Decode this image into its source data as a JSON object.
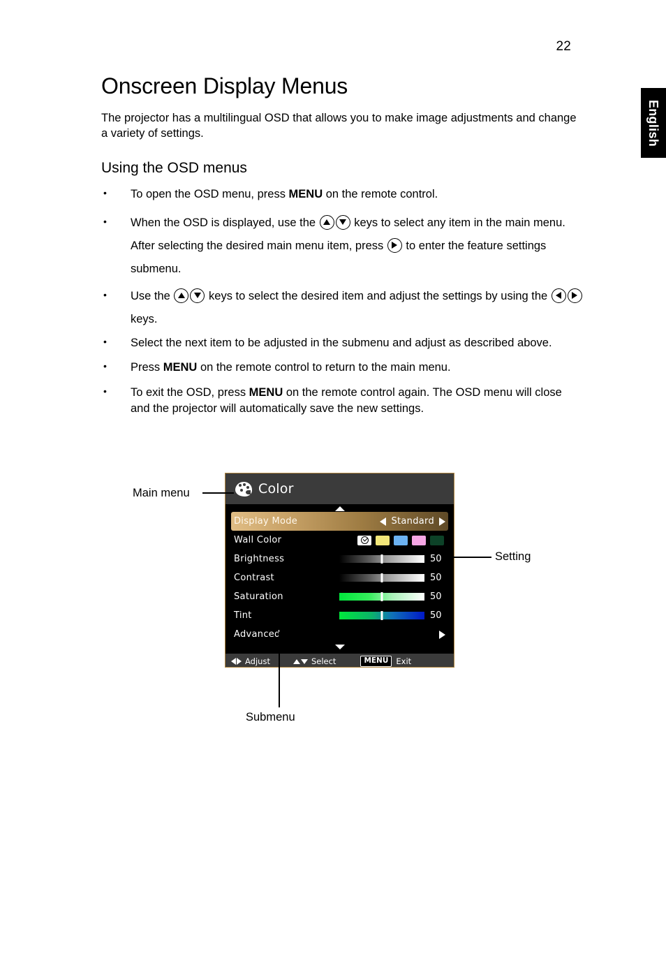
{
  "page": {
    "number": "22",
    "language_tab": "English"
  },
  "article": {
    "title": "Onscreen Display Menus",
    "intro": "The projector has a multilingual OSD that allows you to make image adjustments and change a variety of settings.",
    "subtitle": "Using the OSD menus",
    "bullets": {
      "b1_a": "To open the OSD menu, press ",
      "b1_b": "MENU",
      "b1_c": " on the remote control.",
      "b2_a": "When the OSD is displayed, use the ",
      "b2_b": " keys to select any item in the main menu. After selecting the desired main menu item, press ",
      "b2_c": " to enter the feature settings submenu.",
      "b3_a": "Use the ",
      "b3_b": " keys to select the desired item and adjust the settings by using the ",
      "b3_c": " keys.",
      "b4": "Select the next item to be adjusted in the submenu and adjust as described above.",
      "b5_a": "Press ",
      "b5_b": "MENU",
      "b5_c": " on the remote control to return to the main menu.",
      "b6_a": "To exit the OSD, press ",
      "b6_b": "MENU",
      "b6_c": " on the remote control again. The OSD menu will close and the projector will automatically save the new settings."
    }
  },
  "callouts": {
    "main_menu": "Main menu",
    "setting": "Setting",
    "submenu": "Submenu"
  },
  "osd": {
    "header_title": "Color",
    "header_icon": "palette-icon",
    "scroll_up_icon": "scroll-up-arrow-icon",
    "scroll_down_icon": "scroll-down-arrow-icon",
    "rows": [
      {
        "label": "Display Mode",
        "type": "option",
        "value": "Standard",
        "selected": true
      },
      {
        "label": "Wall Color",
        "type": "swatches",
        "value": ""
      },
      {
        "label": "Brightness",
        "type": "slider",
        "style": "bw",
        "value": "50",
        "position": 50
      },
      {
        "label": "Contrast",
        "type": "slider",
        "style": "bw",
        "value": "50",
        "position": 50
      },
      {
        "label": "Saturation",
        "type": "slider",
        "style": "sat",
        "value": "50",
        "position": 50
      },
      {
        "label": "Tint",
        "type": "slider",
        "style": "tint",
        "value": "50",
        "position": 50
      },
      {
        "label": "Advanced",
        "type": "submenu",
        "value": ""
      }
    ],
    "swatches": [
      {
        "name": "wall-color-off-checked",
        "color": "#ffffff"
      },
      {
        "name": "wall-color-yellow",
        "color": "#f2e679"
      },
      {
        "name": "wall-color-blue",
        "color": "#6cb2f2"
      },
      {
        "name": "wall-color-pink",
        "color": "#f7a6e5"
      },
      {
        "name": "wall-color-dark-green",
        "color": "#0d4228"
      }
    ],
    "footer": {
      "adjust_label": "Adjust",
      "select_label": "Select",
      "menu_key_label": "MENU",
      "exit_label": "Exit"
    },
    "colors": {
      "border": "#b2873f",
      "header_bg": "#3b3b3b",
      "body_bg": "#000000",
      "highlight_start": "#e0bd85",
      "highlight_end": "#5f4a27"
    }
  }
}
